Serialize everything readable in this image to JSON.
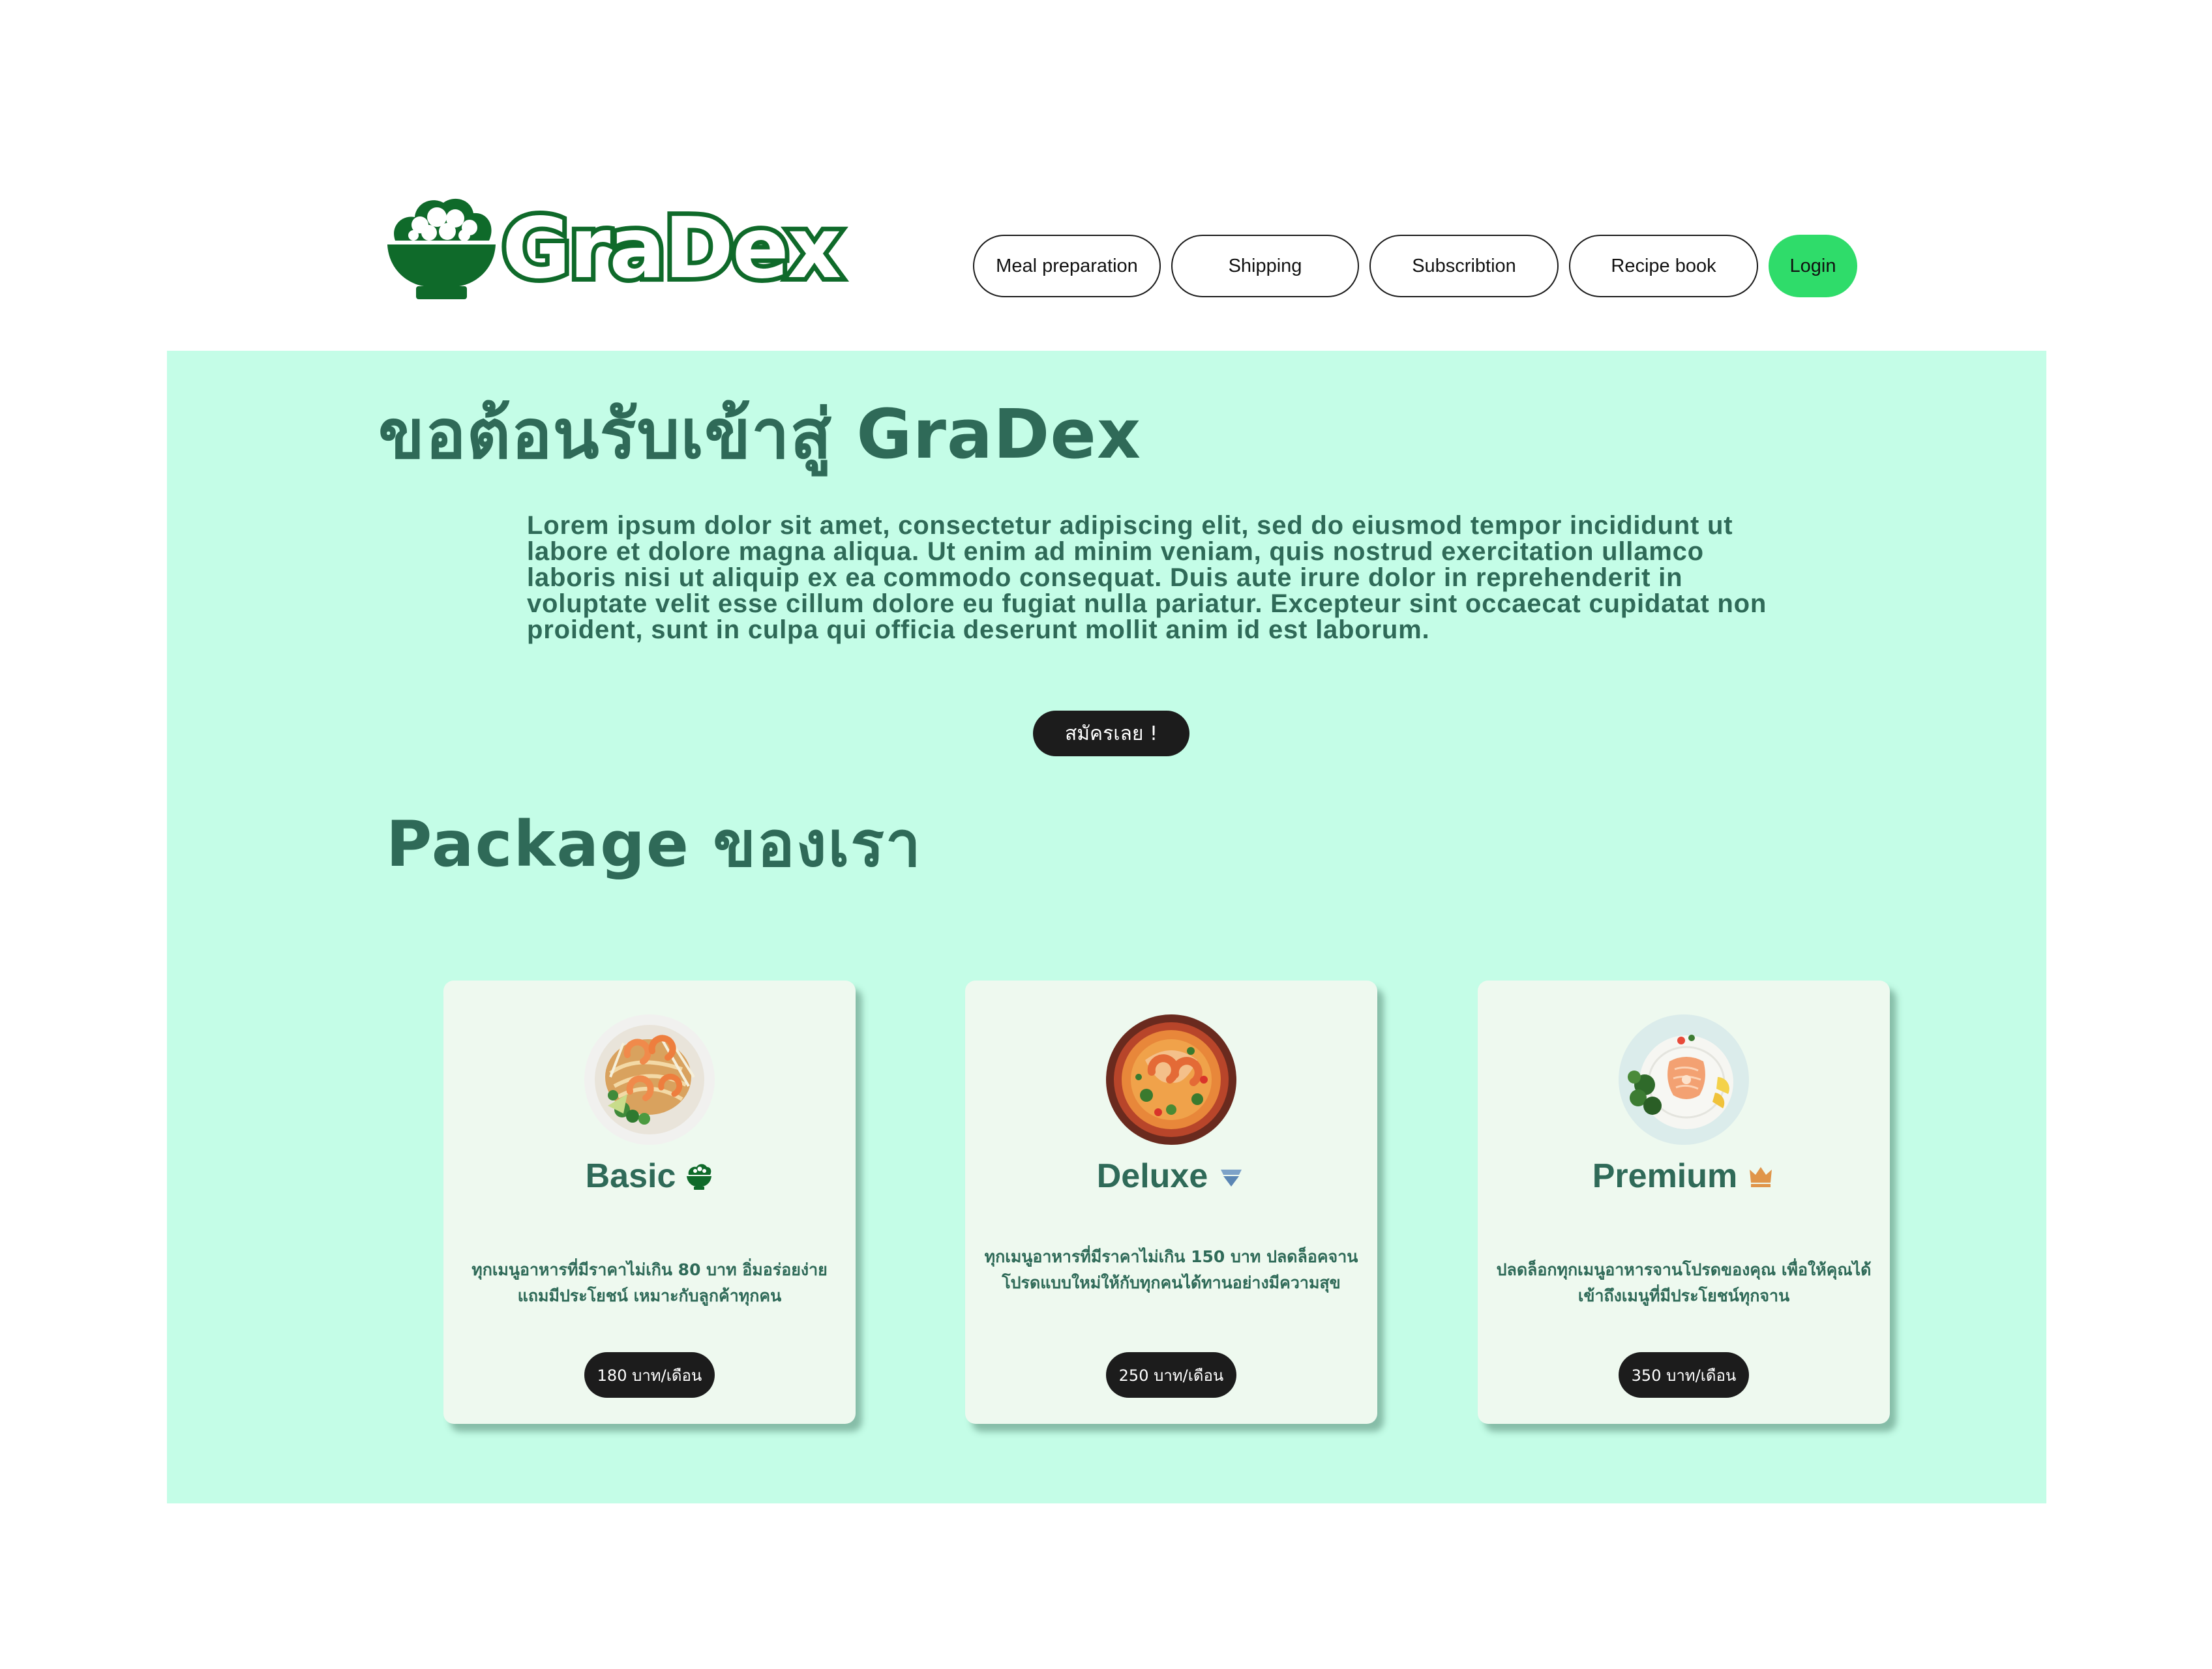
{
  "colors": {
    "brand_green": "#0f6a2a",
    "login_green": "#2fdc6a",
    "hero_background": "#c4fde7",
    "heading_text": "#2f6a58",
    "card_background": "#eef9ef",
    "dark_button": "#1c1c1c"
  },
  "header": {
    "logo_text": "GraDex",
    "logo_icon": "rice-bowl-icon",
    "nav": {
      "meal_preparation": "Meal preparation",
      "shipping": "Shipping",
      "subscription": "Subscribtion",
      "recipe_book": "Recipe book",
      "login": "Login"
    }
  },
  "hero": {
    "title": "ขอต้อนรับเข้าสู่ GraDex",
    "body": "Lorem ipsum dolor sit amet, consectetur adipiscing elit, sed do eiusmod tempor incididunt ut labore et dolore magna aliqua. Ut enim ad minim veniam, quis nostrud exercitation ullamco laboris nisi ut aliquip ex ea commodo consequat. Duis aute irure dolor in reprehenderit in voluptate velit esse cillum dolore eu fugiat nulla pariatur. Excepteur sint occaecat cupidatat non proident, sunt in culpa qui officia deserunt mollit anim id est laborum.",
    "cta": "สมัครเลย !"
  },
  "packages": {
    "title": "Package ของเรา",
    "cards": [
      {
        "name": "Basic",
        "icon": "rice-bowl-icon",
        "image": "pad-thai-dish",
        "description": "ทุกเมนูอาหารที่มีราคาไม่เกิน 80 บาท อิ่มอร่อยง่าย แถมมีประโยชน์ เหมาะกับลูกค้าทุกคน",
        "price": "180 บาท/เดือน"
      },
      {
        "name": "Deluxe",
        "icon": "diamond-icon",
        "image": "tom-yum-dish",
        "description": "ทุกเมนูอาหารที่มีราคาไม่เกิน 150 บาท ปลดล็อคจานโปรดแบบใหม่ให้กับทุกคนได้ทานอย่างมีความสุข",
        "price": "250 บาท/เดือน"
      },
      {
        "name": "Premium",
        "icon": "crown-icon",
        "image": "salmon-steak-dish",
        "description": "ปลดล็อกทุกเมนูอาหารจานโปรดของคุณ เพื่อให้คุณได้เข้าถึงเมนูที่มีประโยชน์ทุกจาน",
        "price": "350 บาท/เดือน"
      }
    ]
  }
}
